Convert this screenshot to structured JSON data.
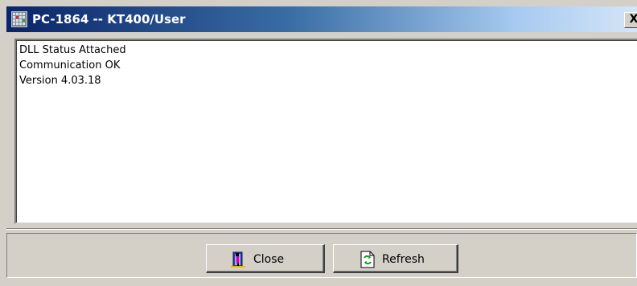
{
  "window": {
    "title": "PC-1864 -- KT400/User",
    "close_glyph": "X",
    "icon": "app-grid-icon"
  },
  "status": {
    "lines": [
      "DLL Status Attached",
      "Communication OK",
      "Version 4.03.18"
    ]
  },
  "buttons": {
    "close_label": "Close",
    "close_icon": "door-exit-icon",
    "refresh_label": "Refresh",
    "refresh_icon": "refresh-arrows-icon"
  },
  "colors": {
    "titlebar_start": "#0a246a",
    "titlebar_end": "#d6e6f8",
    "face": "#d4d0c8"
  }
}
